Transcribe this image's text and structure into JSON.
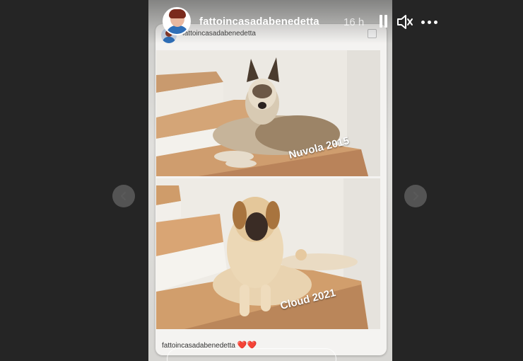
{
  "header": {
    "username": "fattoincasadabenedetta",
    "time": "16 h"
  },
  "card": {
    "top_username": "fattoincasadabenedetta",
    "photos": [
      {
        "caption": "Nuvola 2015"
      },
      {
        "caption": "Cloud 2021"
      }
    ],
    "bottom_caption_user": "fattoincasadabenedetta",
    "bottom_caption_emoji": "❤️❤️"
  },
  "icons": {
    "avatar": "profile-avatar",
    "pause": "pause-icon",
    "mute": "muted-speaker-icon",
    "more": "more-horizontal-icon",
    "prev": "chevron-left-icon",
    "next": "chevron-right-icon",
    "copy": "copy-icon"
  },
  "colors": {
    "background": "#242526",
    "heart": "#e0243a",
    "username_text": "#ffffff"
  }
}
